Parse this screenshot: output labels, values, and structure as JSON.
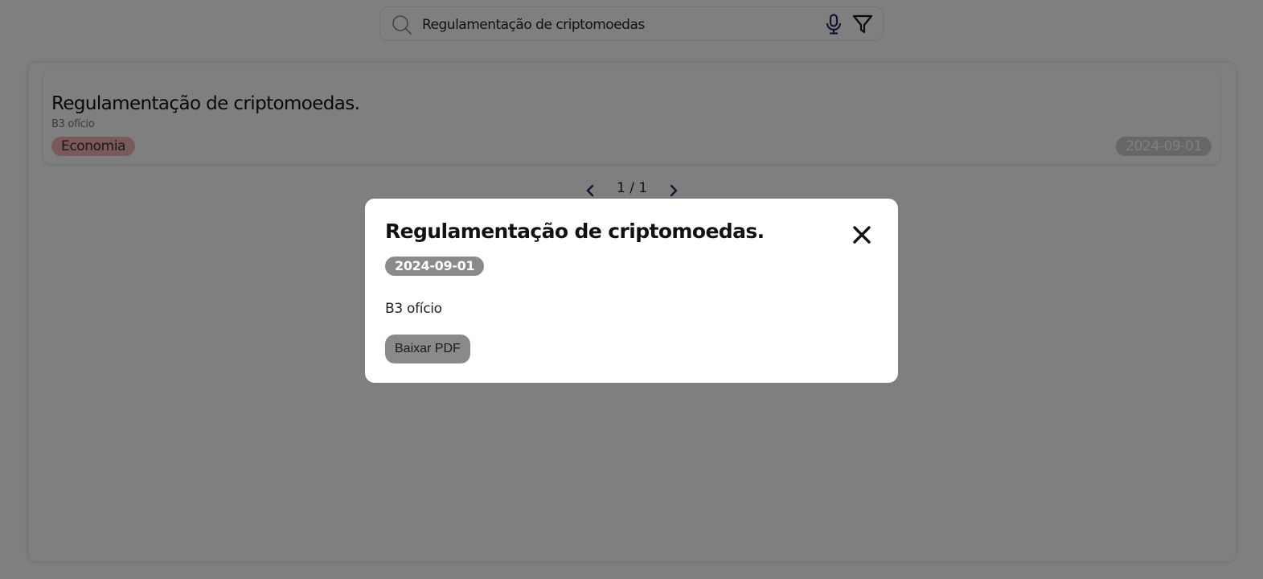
{
  "search": {
    "value": "Regulamentação de criptomoedas",
    "icons": {
      "search": "search-icon",
      "mic": "mic-icon",
      "filter": "filter-icon"
    }
  },
  "results": [
    {
      "title": "Regulamentação de criptomoedas.",
      "source": "B3 ofício",
      "tag": "Economia",
      "date": "2024-09-01"
    }
  ],
  "pagination": {
    "text": "1 / 1"
  },
  "modal": {
    "title": "Regulamentação de criptomoedas.",
    "date": "2024-09-01",
    "source": "B3 ofício",
    "download_label": "Baixar PDF"
  },
  "colors": {
    "tag_bg": "#f2b3b3",
    "date_badge_bg": "#cfcfcf",
    "accent_blue": "#1c2f5e",
    "overlay": "rgba(0,0,0,0.5)"
  }
}
